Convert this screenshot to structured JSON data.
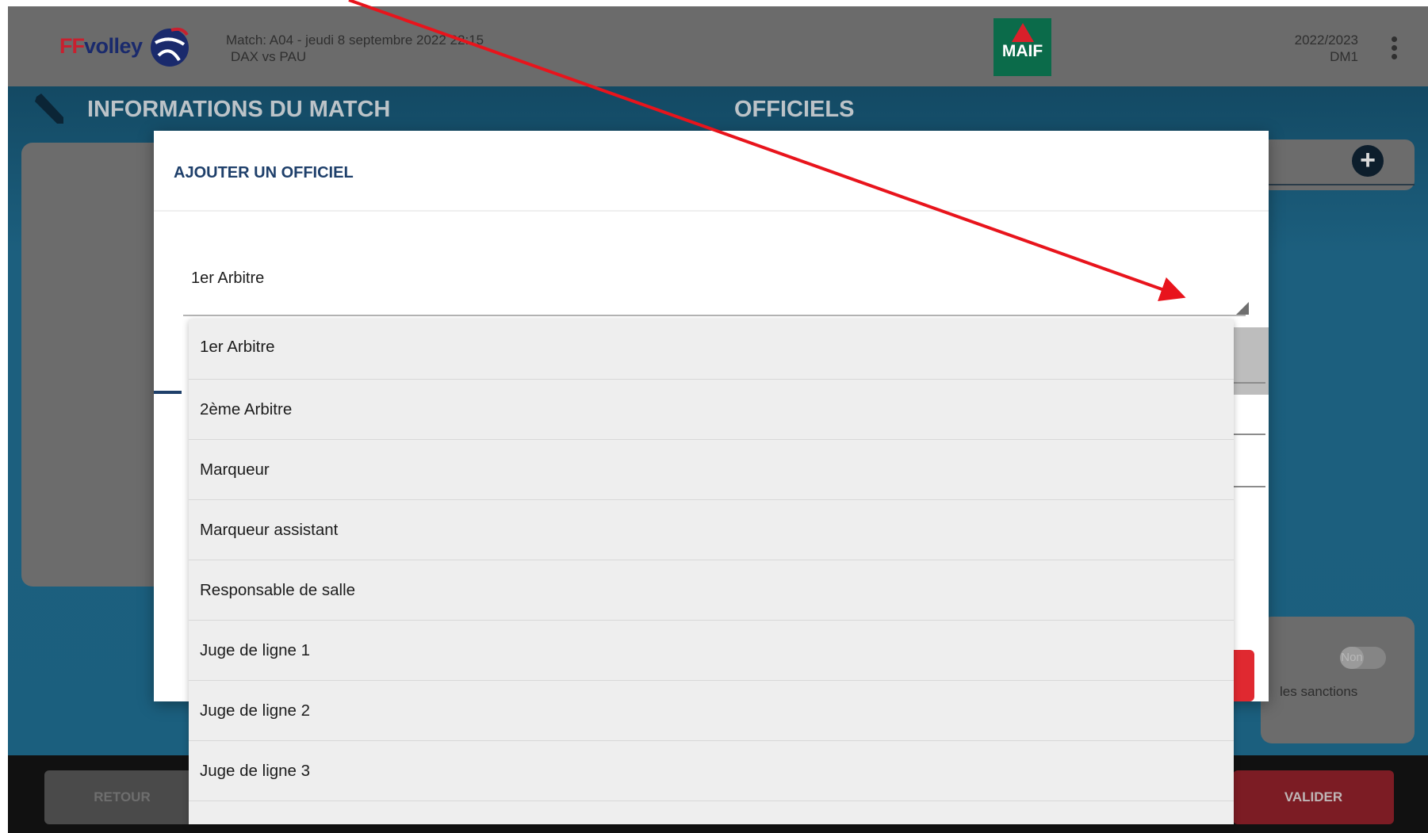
{
  "header": {
    "logo_ff": "FF",
    "logo_volley": "volley",
    "match_line1": "Match: A04 - jeudi 8 septembre 2022 22:15",
    "match_line2": "DAX vs PAU",
    "sponsor": "MAIF",
    "season": "2022/2023",
    "division": "DM1",
    "menu_icon": "kebab-menu-icon"
  },
  "sections": {
    "info": "INFORMATIONS DU MATCH",
    "officials": "OFFICIELS"
  },
  "background": {
    "toggle_label": "Non",
    "sanctions_text": "les sanctions"
  },
  "footer": {
    "back_label": "RETOUR",
    "validate_label": "VALIDER"
  },
  "dialog": {
    "title": "AJOUTER UN OFFICIEL",
    "selected_value": "1er Arbitre",
    "options": [
      "1er Arbitre",
      "2ème Arbitre",
      "Marqueur",
      "Marqueur assistant",
      "Responsable de salle",
      "Juge de ligne 1",
      "Juge de ligne 2",
      "Juge de ligne 3"
    ]
  },
  "colors": {
    "primary_navy": "#1e3f6a",
    "accent_red": "#e02930",
    "annotation_red": "#e8141c",
    "maif_green": "#0b6b4a"
  }
}
